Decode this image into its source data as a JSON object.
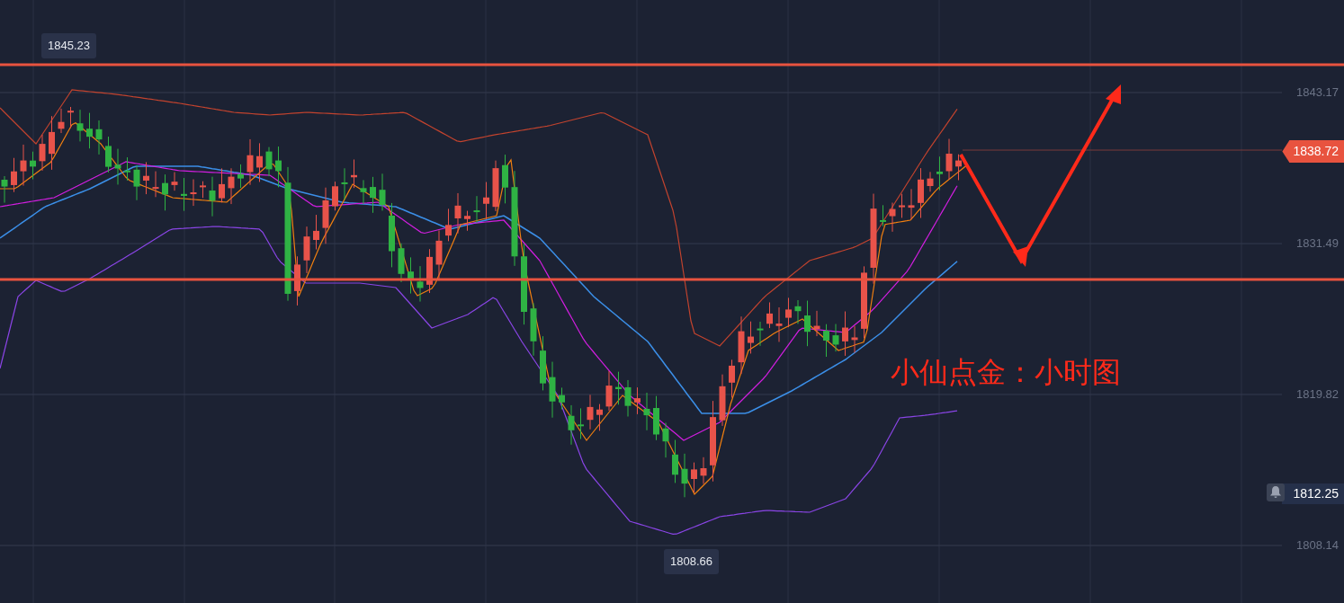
{
  "chart": {
    "annotation": "小仙点金：小时图",
    "price_axis": [
      "1843.17",
      "1831.49",
      "1819.82",
      "1808.14"
    ],
    "current_price": "1838.72",
    "alert_price": "1812.25",
    "high_marker": "1845.23",
    "low_marker": "1808.66"
  }
}
